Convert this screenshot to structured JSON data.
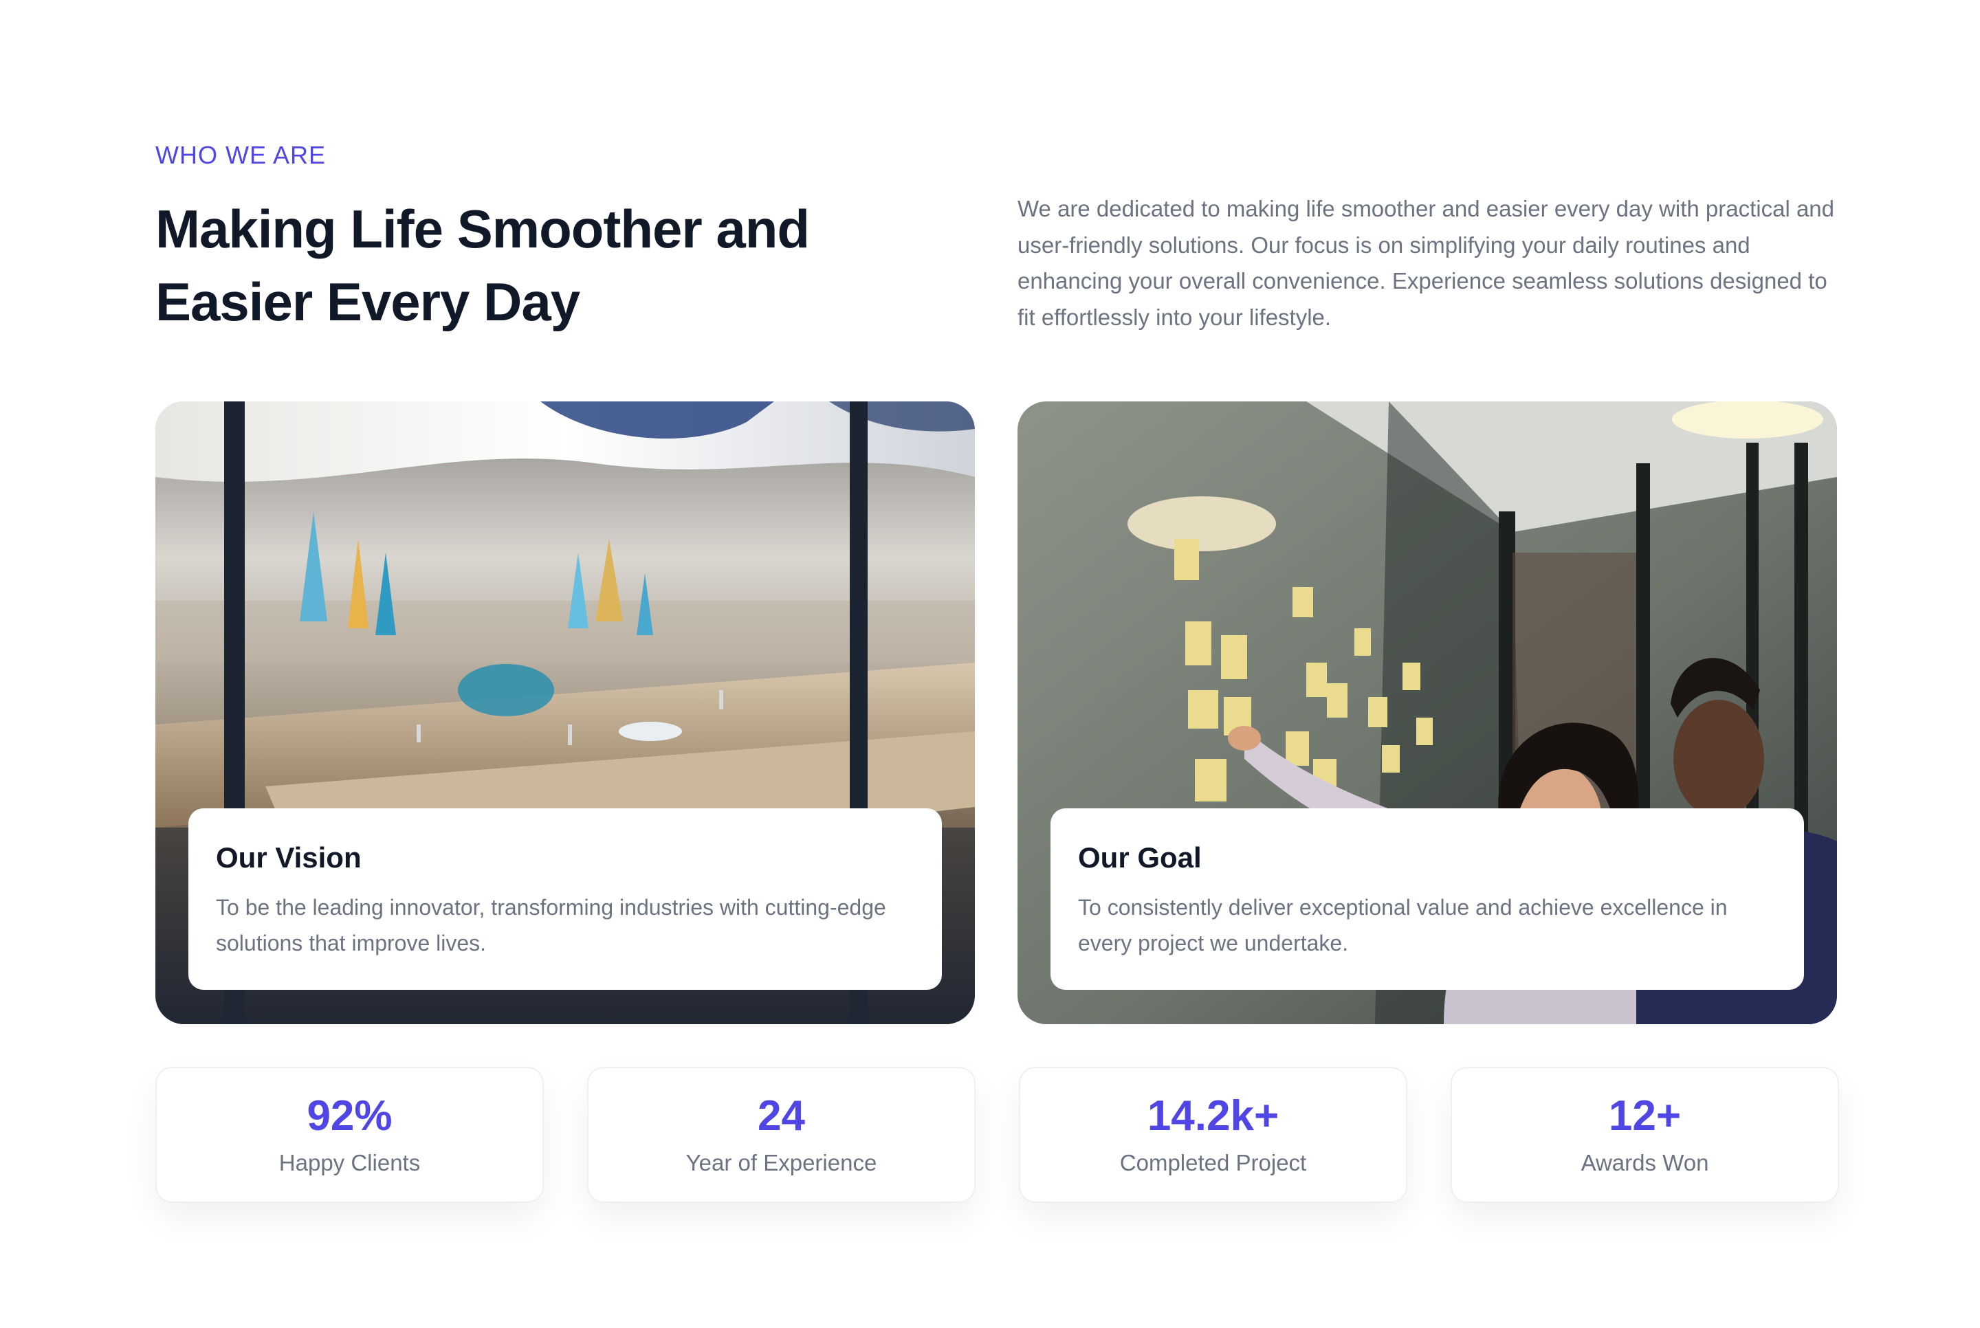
{
  "about": {
    "eyebrow": "WHO WE ARE",
    "headline_line1": "Making Life Smoother and",
    "headline_line2": "Easier Every Day",
    "intro": "We are dedicated to making life smoother and easier every day with practical and user-friendly solutions. Our focus is on simplifying your daily routines and enhancing your overall convenience. Experience seamless solutions designed to fit effortlessly into your lifestyle."
  },
  "cards": [
    {
      "title": "Our Vision",
      "text": "To be the leading innovator, transforming industries with cutting-edge solutions that improve lives.",
      "image": "architectural-model-photo"
    },
    {
      "title": "Our Goal",
      "text": "To consistently deliver exceptional value and achieve excellence in every project we undertake.",
      "image": "team-sticky-notes-photo"
    }
  ],
  "stats": [
    {
      "value": "92%",
      "label": "Happy Clients"
    },
    {
      "value": "24",
      "label": "Year of Experience"
    },
    {
      "value": "14.2k+",
      "label": "Completed Project"
    },
    {
      "value": "12+",
      "label": "Awards Won"
    }
  ],
  "colors": {
    "accent": "#4f46e5",
    "heading": "#111827",
    "body_text": "#6b7280",
    "background": "#ffffff"
  }
}
